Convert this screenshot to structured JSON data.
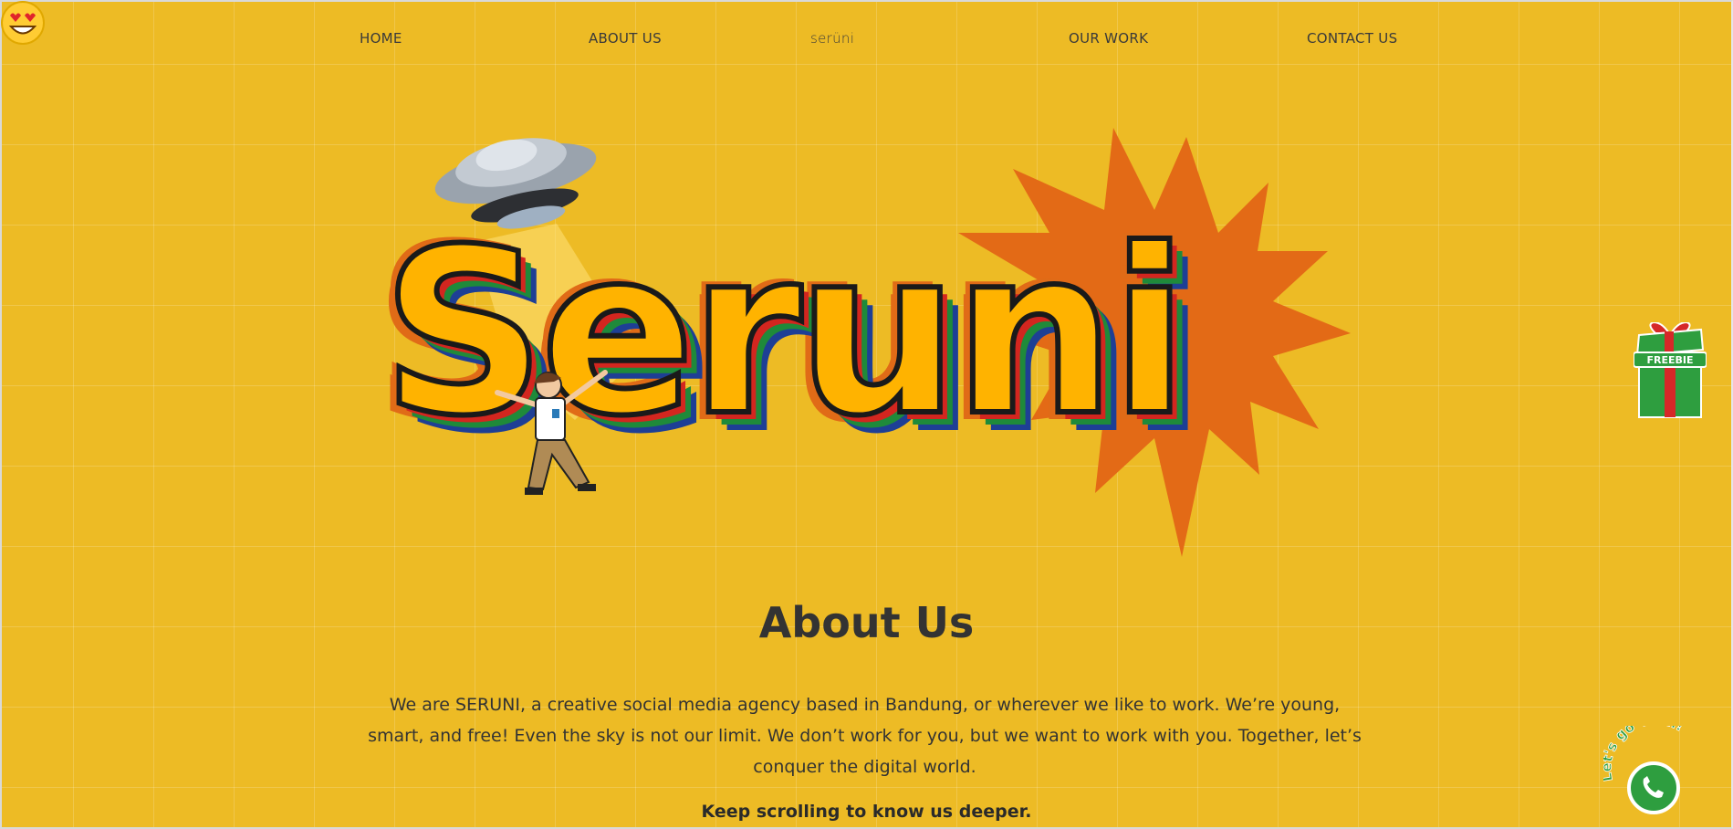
{
  "nav": {
    "home": "HOME",
    "about": "ABOUT US",
    "logo": "serüni",
    "work": "OUR WORK",
    "contact": "CONTACT US"
  },
  "hero": {
    "logo_text": "Seruni",
    "icons": [
      "ufo-icon",
      "starburst-icon",
      "person-illustration",
      "heart-eyes-emoji-icon"
    ]
  },
  "about": {
    "title": "About Us",
    "body": "We are SERUNI, a creative social media agency based in Bandung, or wherever we like to work. We’re young, smart, and free! Even the sky is not our limit. We don’t work for you, but we want to work with you. Together, let’s conquer the digital world.",
    "cta": "Keep scrolling to know us deeper."
  },
  "widgets": {
    "freebie_label": "FREEBIE",
    "whatsapp_label": "Let's go Viral!"
  },
  "colors": {
    "background": "#EDBB25",
    "starburst": "#E36A16",
    "letter_fill": "#FFB300",
    "text": "#333333",
    "whatsapp_green": "#2E9E3F"
  }
}
